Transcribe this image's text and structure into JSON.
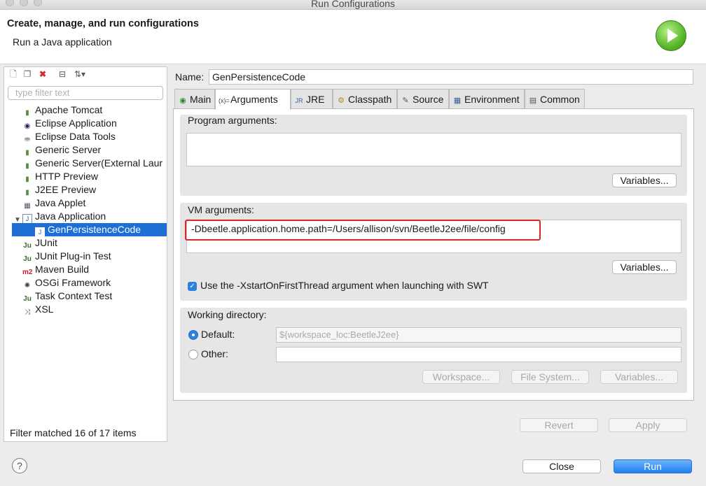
{
  "window": {
    "title": "Run Configurations"
  },
  "header": {
    "title": "Create, manage, and run configurations",
    "subtitle": "Run a Java application",
    "icon": "run-icon"
  },
  "left": {
    "filter_placeholder": "type filter text",
    "items": [
      {
        "label": "Apache Tomcat",
        "icon": "server-icon"
      },
      {
        "label": "Eclipse Application",
        "icon": "eclipse-icon"
      },
      {
        "label": "Eclipse Data Tools",
        "icon": "database-icon"
      },
      {
        "label": "Generic Server",
        "icon": "server-icon"
      },
      {
        "label": "Generic Server(External Laur",
        "icon": "server-icon"
      },
      {
        "label": "HTTP Preview",
        "icon": "server-icon"
      },
      {
        "label": "J2EE Preview",
        "icon": "server-icon"
      },
      {
        "label": "Java Applet",
        "icon": "applet-icon"
      },
      {
        "label": "Java Application",
        "icon": "java-app-icon",
        "expanded": true
      },
      {
        "label": "GenPersistenceCode",
        "icon": "java-class-icon",
        "selected": true
      },
      {
        "label": "JUnit",
        "icon": "junit-icon"
      },
      {
        "label": "JUnit Plug-in Test",
        "icon": "junit-plugin-icon"
      },
      {
        "label": "Maven Build",
        "icon": "maven-icon"
      },
      {
        "label": "OSGi Framework",
        "icon": "osgi-icon"
      },
      {
        "label": "Task Context Test",
        "icon": "task-test-icon"
      },
      {
        "label": "XSL",
        "icon": "xsl-icon"
      }
    ],
    "status": "Filter matched 16 of 17 items"
  },
  "config": {
    "name_label": "Name:",
    "name_value": "GenPersistenceCode",
    "tabs": [
      {
        "label": "Main",
        "icon": "main-icon"
      },
      {
        "label": "Arguments",
        "icon": "arguments-icon",
        "active": true
      },
      {
        "label": "JRE",
        "icon": "jre-icon"
      },
      {
        "label": "Classpath",
        "icon": "classpath-icon"
      },
      {
        "label": "Source",
        "icon": "source-icon"
      },
      {
        "label": "Environment",
        "icon": "environment-icon"
      },
      {
        "label": "Common",
        "icon": "common-icon"
      }
    ],
    "program_args": {
      "label": "Program arguments:",
      "value": "",
      "variables": "Variables..."
    },
    "vm_args": {
      "label": "VM arguments:",
      "value": "-Dbeetle.application.home.path=/Users/allison/svn/BeetleJ2ee/file/config",
      "variables": "Variables..."
    },
    "swt_checkbox": {
      "label": "Use the -XstartOnFirstThread argument when launching with SWT",
      "checked": true
    },
    "working_dir": {
      "label": "Working directory:",
      "default_label": "Default:",
      "default_value": "${workspace_loc:BeetleJ2ee}",
      "other_label": "Other:",
      "other_value": "",
      "workspace_btn": "Workspace...",
      "filesystem_btn": "File System...",
      "variables_btn": "Variables..."
    },
    "revert": "Revert",
    "apply": "Apply"
  },
  "footer": {
    "close": "Close",
    "run": "Run",
    "help": "?"
  },
  "colors": {
    "selection": "#1d6fd6",
    "run_button": "#1f7fef",
    "highlight": "#e0252a"
  }
}
